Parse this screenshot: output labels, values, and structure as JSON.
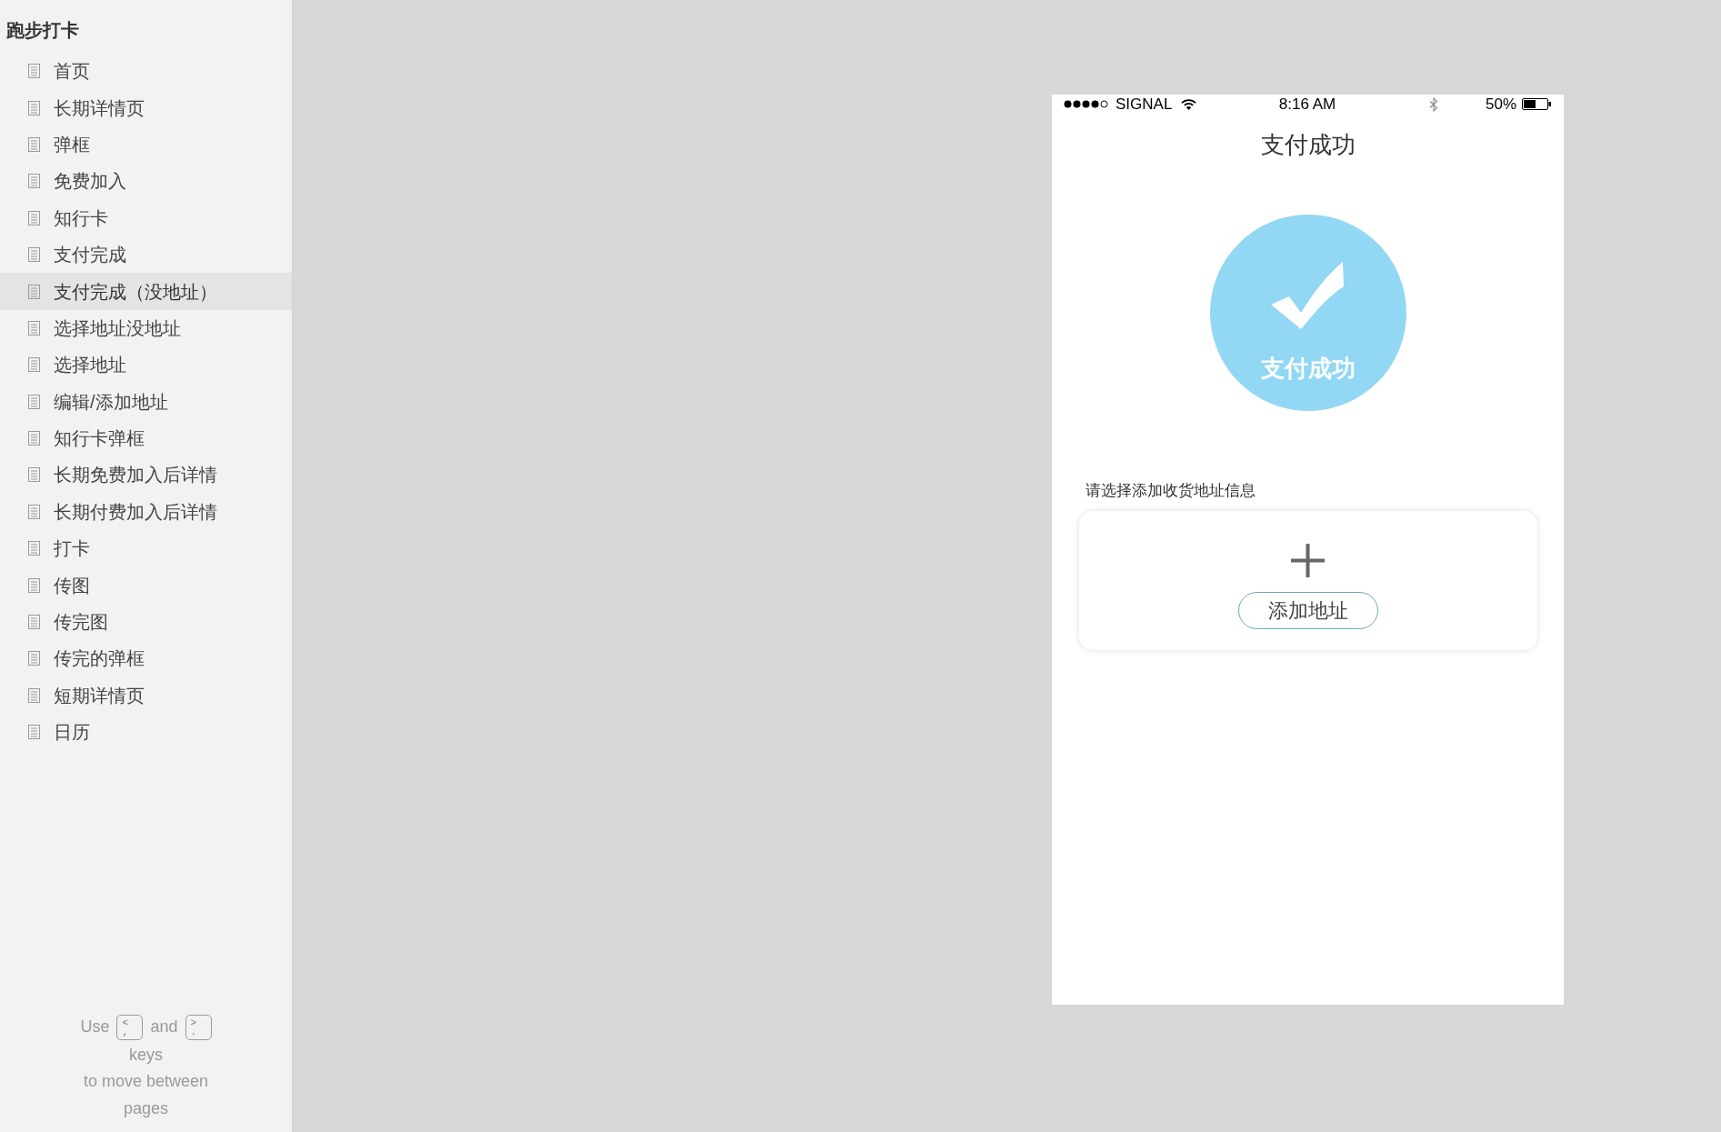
{
  "sidebar": {
    "title": "跑步打卡",
    "pages": [
      {
        "label": "首页",
        "selected": false
      },
      {
        "label": "长期详情页",
        "selected": false
      },
      {
        "label": "弹框",
        "selected": false
      },
      {
        "label": "免费加入",
        "selected": false
      },
      {
        "label": "知行卡",
        "selected": false
      },
      {
        "label": "支付完成",
        "selected": false
      },
      {
        "label": "支付完成（没地址）",
        "selected": true
      },
      {
        "label": "选择地址没地址",
        "selected": false
      },
      {
        "label": "选择地址",
        "selected": false
      },
      {
        "label": "编辑/添加地址",
        "selected": false
      },
      {
        "label": "知行卡弹框",
        "selected": false
      },
      {
        "label": "长期免费加入后详情",
        "selected": false
      },
      {
        "label": "长期付费加入后详情",
        "selected": false
      },
      {
        "label": "打卡",
        "selected": false
      },
      {
        "label": "传图",
        "selected": false
      },
      {
        "label": "传完图",
        "selected": false
      },
      {
        "label": "传完的弹框",
        "selected": false
      },
      {
        "label": "短期详情页",
        "selected": false
      },
      {
        "label": "日历",
        "selected": false
      }
    ],
    "hint": {
      "lead": "Use",
      "keys": [
        {
          "upper": "<",
          "lower": ","
        },
        {
          "upper": ">",
          "lower": "."
        }
      ],
      "joiner": "and",
      "lines": [
        "keys",
        "to move between",
        "pages"
      ]
    }
  },
  "phone": {
    "status_bar": {
      "carrier": "SIGNAL",
      "time": "8:16 AM",
      "battery": "50%"
    },
    "title": "支付成功",
    "success_badge": {
      "label": "支付成功"
    },
    "address_prompt": "请选择添加收货地址信息",
    "add_address_button": "添加地址"
  }
}
